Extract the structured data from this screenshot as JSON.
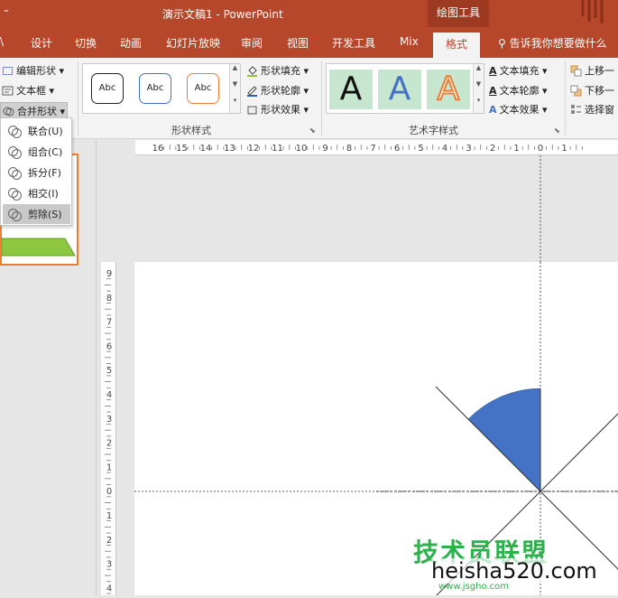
{
  "titlebar": {
    "quick_access": "⁼",
    "title": "演示文稿1  -  PowerPoint",
    "context_tab": "绘图工具"
  },
  "tabs": {
    "partial": "\\",
    "items": [
      "设计",
      "切换",
      "动画",
      "幻灯片放映",
      "审阅",
      "视图",
      "开发工具",
      "Mix",
      "格式"
    ],
    "active": "格式",
    "tell_me": "告诉我你想要做什么"
  },
  "ribbon": {
    "insert_shapes": {
      "edit_shape": "编辑形状 ▾",
      "text_box": "文本框 ▾",
      "merge_shapes": "合并形状 ▾"
    },
    "shape_styles": {
      "samples": [
        "Abc",
        "Abc",
        "Abc"
      ],
      "fill": "形状填充 ▾",
      "outline": "形状轮廓 ▾",
      "effects": "形状效果 ▾",
      "label": "形状样式"
    },
    "wordart_styles": {
      "samples": [
        "A",
        "A",
        "A"
      ],
      "text_fill": "文本填充 ▾",
      "text_outline": "文本轮廓 ▾",
      "text_effects": "文本效果 ▾",
      "label": "艺术字样式"
    },
    "arrange": {
      "bring_forward": "上移一",
      "send_backward": "下移一",
      "selection_pane": "选择窗"
    }
  },
  "merge_menu": {
    "items": [
      "联合(U)",
      "组合(C)",
      "拆分(F)",
      "相交(I)",
      "剪除(S)"
    ],
    "highlighted": "剪除(S)"
  },
  "rulers": {
    "horizontal_labels": [
      "16",
      "15",
      "14",
      "13",
      "12",
      "11",
      "10",
      "9",
      "8",
      "7",
      "6",
      "5",
      "4",
      "3",
      "2",
      "1",
      "0",
      "1"
    ],
    "vertical_labels": [
      "9",
      "8",
      "7",
      "6",
      "5",
      "4",
      "3",
      "2",
      "1",
      "0",
      "1",
      "2",
      "3",
      "4"
    ]
  },
  "watermark": {
    "line1": "技术员联盟",
    "line2": "heisha520.com",
    "line3": "www.jsgho.com"
  },
  "colors": {
    "ribbon_brand": "#b7472a",
    "shape_fill": "#4472c4",
    "thumb_border": "#ed7d31",
    "thumb_shape": "#8dc63f",
    "watermark_green": "#2bb24c"
  }
}
